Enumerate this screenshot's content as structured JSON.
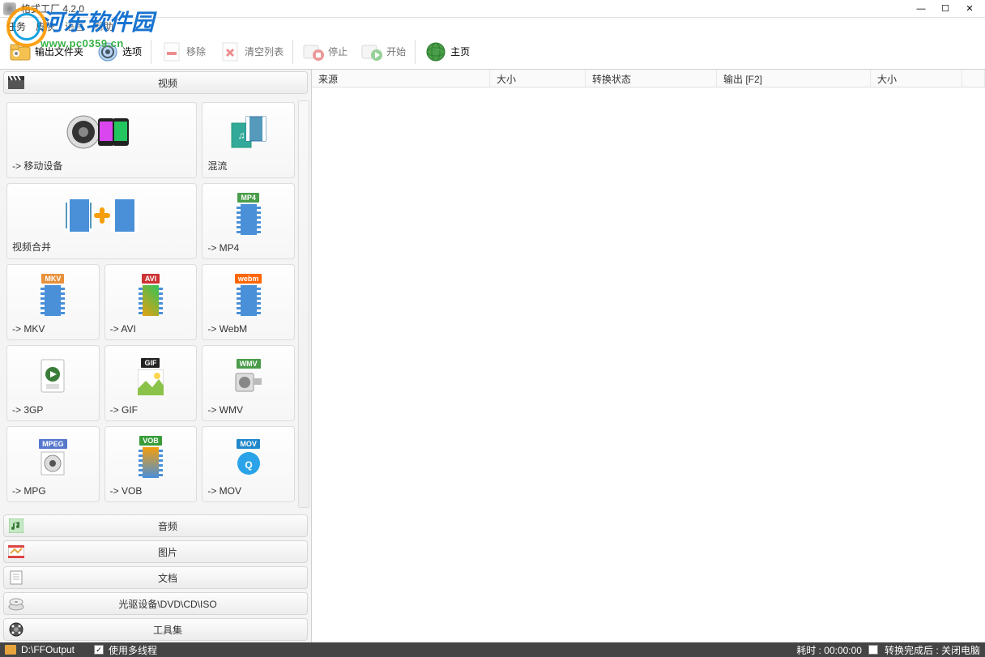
{
  "window": {
    "title": "格式工厂 4.2.0"
  },
  "watermark": {
    "brand": "河东软件园",
    "url": "www.pc0359.cn"
  },
  "menu": {
    "task": "任务",
    "skin": "皮肤",
    "language": "语言",
    "help": "帮助"
  },
  "toolbar": {
    "output_folder": "输出文件夹",
    "options": "选项",
    "remove": "移除",
    "clear_list": "清空列表",
    "stop": "停止",
    "start": "开始",
    "homepage": "主页"
  },
  "categories": {
    "video": "视频",
    "audio": "音频",
    "picture": "图片",
    "document": "文档",
    "optical": "光驱设备\\DVD\\CD\\ISO",
    "toolset": "工具集"
  },
  "video_tiles": {
    "mobile": "-> 移动设备",
    "mux": "混流",
    "merge": "视频合并",
    "mp4": "-> MP4",
    "mkv": "-> MKV",
    "avi": "-> AVI",
    "webm": "-> WebM",
    "gp3": "-> 3GP",
    "gif": "-> GIF",
    "wmv": "-> WMV",
    "mpg": "-> MPG",
    "vob": "-> VOB",
    "mov": "-> MOV"
  },
  "table": {
    "col_source": "来源",
    "col_size": "大小",
    "col_status": "转换状态",
    "col_output": "输出 [F2]",
    "col_size2": "大小"
  },
  "statusbar": {
    "output_path": "D:\\FFOutput",
    "multithread": "使用多线程",
    "elapsed": "耗时 : 00:00:00",
    "after_convert": "转换完成后 : 关闭电脑"
  }
}
